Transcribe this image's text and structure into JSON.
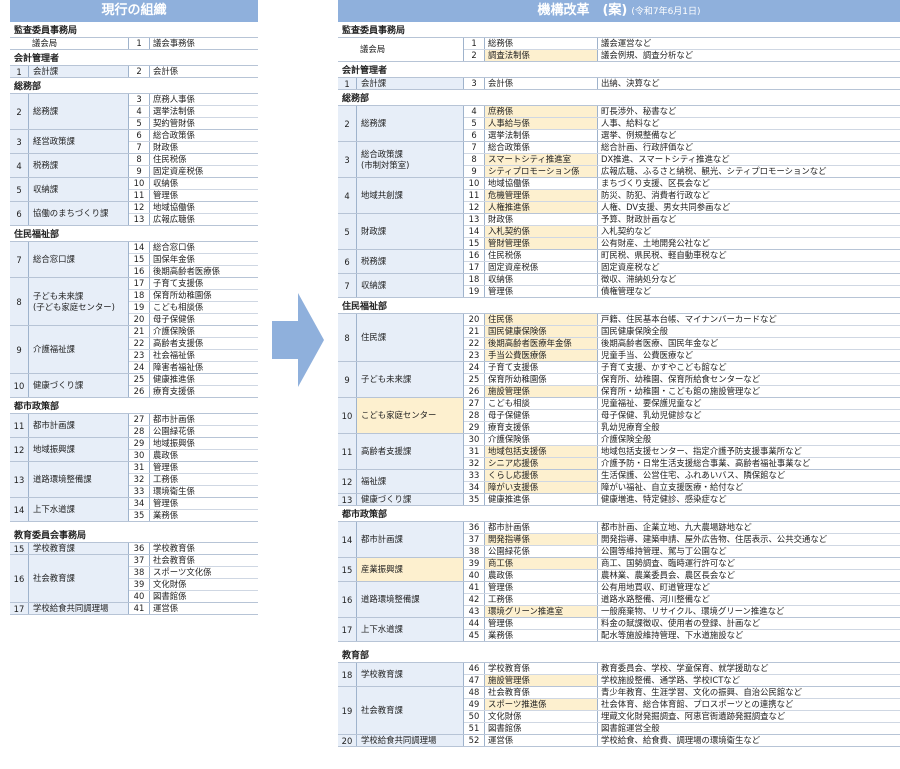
{
  "colors": {
    "header": "#8fb0dc",
    "dept_bg": "#e7eef8",
    "highlight": "#fdf0cf"
  },
  "left": {
    "title": "現行の組織",
    "sections": [
      {
        "name": "監査委員事務局",
        "blocks": [
          {
            "num": "",
            "dept": "議会局",
            "white": true,
            "rows": [
              {
                "n": "1",
                "s": "議会事務係"
              }
            ]
          }
        ]
      },
      {
        "name": "会計管理者",
        "blocks": [
          {
            "num": "1",
            "dept": "会計課",
            "rows": [
              {
                "n": "2",
                "s": "会計係"
              }
            ]
          }
        ]
      },
      {
        "name": "総務部",
        "blocks": [
          {
            "num": "2",
            "dept": "総務課",
            "rows": [
              {
                "n": "3",
                "s": "庶務人事係"
              },
              {
                "n": "4",
                "s": "選挙法制係"
              },
              {
                "n": "5",
                "s": "契約管財係"
              }
            ]
          },
          {
            "num": "3",
            "dept": "経営政策課",
            "rows": [
              {
                "n": "6",
                "s": "総合政策係"
              },
              {
                "n": "7",
                "s": "財政係"
              }
            ]
          },
          {
            "num": "4",
            "dept": "税務課",
            "rows": [
              {
                "n": "8",
                "s": "住民税係"
              },
              {
                "n": "9",
                "s": "固定資産税係"
              }
            ]
          },
          {
            "num": "5",
            "dept": "収納課",
            "rows": [
              {
                "n": "10",
                "s": "収納係"
              },
              {
                "n": "11",
                "s": "管理係"
              }
            ]
          },
          {
            "num": "6",
            "dept": "協働のまちづくり課",
            "rows": [
              {
                "n": "12",
                "s": "地域協働係"
              },
              {
                "n": "13",
                "s": "広報広聴係"
              }
            ]
          }
        ]
      },
      {
        "name": "住民福祉部",
        "blocks": [
          {
            "num": "7",
            "dept": "総合窓口課",
            "rows": [
              {
                "n": "14",
                "s": "総合窓口係"
              },
              {
                "n": "15",
                "s": "国保年金係"
              },
              {
                "n": "16",
                "s": "後期高齢者医療係"
              }
            ]
          },
          {
            "num": "8",
            "dept": "子ども未来課\n(子ども家庭センター)",
            "rows": [
              {
                "n": "17",
                "s": "子育て支援係"
              },
              {
                "n": "18",
                "s": "保育所幼稚園係"
              },
              {
                "n": "19",
                "s": "こども相談係"
              },
              {
                "n": "20",
                "s": "母子保健係"
              }
            ]
          },
          {
            "num": "9",
            "dept": "介護福祉課",
            "rows": [
              {
                "n": "21",
                "s": "介護保険係"
              },
              {
                "n": "22",
                "s": "高齢者支援係"
              },
              {
                "n": "23",
                "s": "社会福祉係"
              },
              {
                "n": "24",
                "s": "障害者福祉係"
              }
            ]
          },
          {
            "num": "10",
            "dept": "健康づくり課",
            "rows": [
              {
                "n": "25",
                "s": "健康推進係"
              },
              {
                "n": "26",
                "s": "療育支援係"
              }
            ]
          }
        ]
      },
      {
        "name": "都市政策部",
        "blocks": [
          {
            "num": "11",
            "dept": "都市計画課",
            "rows": [
              {
                "n": "27",
                "s": "都市計画係"
              },
              {
                "n": "28",
                "s": "公園緑花係"
              }
            ]
          },
          {
            "num": "12",
            "dept": "地域振興課",
            "rows": [
              {
                "n": "29",
                "s": "地域振興係"
              },
              {
                "n": "30",
                "s": "農政係"
              }
            ]
          },
          {
            "num": "13",
            "dept": "道路環境整備課",
            "rows": [
              {
                "n": "31",
                "s": "管理係"
              },
              {
                "n": "32",
                "s": "工務係"
              },
              {
                "n": "33",
                "s": "環境衛生係"
              }
            ]
          },
          {
            "num": "14",
            "dept": "上下水道課",
            "rows": [
              {
                "n": "34",
                "s": "管理係"
              },
              {
                "n": "35",
                "s": "業務係"
              }
            ]
          }
        ]
      },
      {
        "name": "教育委員会事務局",
        "gap": true,
        "blocks": [
          {
            "num": "15",
            "dept": "学校教育課",
            "rows": [
              {
                "n": "36",
                "s": "学校教育係"
              }
            ]
          },
          {
            "num": "16",
            "dept": "社会教育課",
            "rows": [
              {
                "n": "37",
                "s": "社会教育係"
              },
              {
                "n": "38",
                "s": "スポーツ文化係"
              },
              {
                "n": "39",
                "s": "文化財係"
              },
              {
                "n": "40",
                "s": "図書館係"
              }
            ]
          },
          {
            "num": "17",
            "dept": "学校給食共同調理場",
            "rows": [
              {
                "n": "41",
                "s": "運営係"
              }
            ]
          }
        ]
      }
    ]
  },
  "right": {
    "title": "機構改革　(案)",
    "date": "(令和7年6月1日)",
    "sections": [
      {
        "name": "監査委員事務局",
        "blocks": [
          {
            "num": "",
            "dept": "議会局",
            "white": true,
            "rows": [
              {
                "n": "1",
                "s": "総務係",
                "d": "議会運営など"
              },
              {
                "n": "2",
                "s": "調査法制係",
                "d": "議会例規、調査分析など",
                "hl": true
              }
            ]
          }
        ]
      },
      {
        "name": "会計管理者",
        "blocks": [
          {
            "num": "1",
            "dept": "会計課",
            "rows": [
              {
                "n": "3",
                "s": "会計係",
                "d": "出納、決算など"
              }
            ]
          }
        ]
      },
      {
        "name": "総務部",
        "blocks": [
          {
            "num": "2",
            "dept": "総務課",
            "rows": [
              {
                "n": "4",
                "s": "庶務係",
                "d": "町長渉外、秘書など",
                "hl": true
              },
              {
                "n": "5",
                "s": "人事給与係",
                "d": "人事、給料など",
                "hl": true
              },
              {
                "n": "6",
                "s": "選挙法制係",
                "d": "選挙、例規整備など"
              }
            ]
          },
          {
            "num": "3",
            "dept": "総合政策課\n(市制対策室)",
            "rows": [
              {
                "n": "7",
                "s": "総合政策係",
                "d": "総合計画、行政評価など"
              },
              {
                "n": "8",
                "s": "スマートシティ推進室",
                "d": "DX推進、スマートシティ推進など",
                "hl": true
              },
              {
                "n": "9",
                "s": "シティプロモーション係",
                "d": "広報広聴、ふるさと納税、観光、シティプロモーションなど",
                "hl": true
              }
            ]
          },
          {
            "num": "4",
            "dept": "地域共創課",
            "rows": [
              {
                "n": "10",
                "s": "地域協働係",
                "d": "まちづくり支援、区長会など"
              },
              {
                "n": "11",
                "s": "危機管理係",
                "d": "防災、防犯、消費者行政など",
                "hl": true
              },
              {
                "n": "12",
                "s": "人権推進係",
                "d": "人権、DV支援、男女共同参画など",
                "hl": true
              }
            ]
          },
          {
            "num": "5",
            "dept": "財政課",
            "rows": [
              {
                "n": "13",
                "s": "財政係",
                "d": "予算、財政計画など"
              },
              {
                "n": "14",
                "s": "入札契約係",
                "d": "入札契約など",
                "hl": true
              },
              {
                "n": "15",
                "s": "管財管理係",
                "d": "公有財産、土地開発公社など",
                "hl": true
              }
            ]
          },
          {
            "num": "6",
            "dept": "税務課",
            "rows": [
              {
                "n": "16",
                "s": "住民税係",
                "d": "町民税、県民税、軽自動車税など"
              },
              {
                "n": "17",
                "s": "固定資産税係",
                "d": "固定資産税など"
              }
            ]
          },
          {
            "num": "7",
            "dept": "収納課",
            "rows": [
              {
                "n": "18",
                "s": "収納係",
                "d": "徴収、滞納処分など"
              },
              {
                "n": "19",
                "s": "管理係",
                "d": "債権管理など"
              }
            ]
          }
        ]
      },
      {
        "name": "住民福祉部",
        "blocks": [
          {
            "num": "8",
            "dept": "住民課",
            "rows": [
              {
                "n": "20",
                "s": "住民係",
                "d": "戸籍、住民基本台帳、マイナンバーカードなど",
                "hl": true
              },
              {
                "n": "21",
                "s": "国民健康保険係",
                "d": "国民健康保険全般",
                "hl": true
              },
              {
                "n": "22",
                "s": "後期高齢者医療年金係",
                "d": "後期高齢者医療、国民年金など",
                "hl": true
              },
              {
                "n": "23",
                "s": "手当公費医療係",
                "d": "児童手当、公費医療など",
                "hl": true
              }
            ]
          },
          {
            "num": "9",
            "dept": "子ども未来課",
            "rows": [
              {
                "n": "24",
                "s": "子育て支援係",
                "d": "子育て支援、かすやこども館など"
              },
              {
                "n": "25",
                "s": "保育所幼稚園係",
                "d": "保育所、幼稚園、保育所給食センターなど"
              },
              {
                "n": "26",
                "s": "施設管理係",
                "d": "保育所・幼稚園・こども館の施設管理など",
                "hl": true
              }
            ]
          },
          {
            "num": "10",
            "dept": "こども家庭センター",
            "hl": true,
            "rows": [
              {
                "n": "27",
                "s": "こども相談",
                "d": "児童福祉、要保護児童など"
              },
              {
                "n": "28",
                "s": "母子保健係",
                "d": "母子保健、乳幼児健診など"
              },
              {
                "n": "29",
                "s": "療育支援係",
                "d": "乳幼児療育全般"
              }
            ]
          },
          {
            "num": "11",
            "dept": "高齢者支援課",
            "rows": [
              {
                "n": "30",
                "s": "介護保険係",
                "d": "介護保険全般"
              },
              {
                "n": "31",
                "s": "地域包括支援係",
                "d": "地域包括支援センター、指定介護予防支援事業所など",
                "hl": true
              },
              {
                "n": "32",
                "s": "シニア応援係",
                "d": "介護予防・日常生活支援総合事業、高齢者福祉事業など",
                "hl": true
              }
            ]
          },
          {
            "num": "12",
            "dept": "福祉課",
            "rows": [
              {
                "n": "33",
                "s": "くらし応援係",
                "d": "生活保護、公営住宅、ふれあいバス、隣保館など",
                "hl": true
              },
              {
                "n": "34",
                "s": "障がい支援係",
                "d": "障がい福祉、自立支援医療・給付など",
                "hl": true
              }
            ]
          },
          {
            "num": "13",
            "dept": "健康づくり課",
            "rows": [
              {
                "n": "35",
                "s": "健康推進係",
                "d": "健康増進、特定健診、感染症など"
              }
            ]
          }
        ]
      },
      {
        "name": "都市政策部",
        "blocks": [
          {
            "num": "14",
            "dept": "都市計画課",
            "rows": [
              {
                "n": "36",
                "s": "都市計画係",
                "d": "都市計画、企業立地、九大農場跡地など"
              },
              {
                "n": "37",
                "s": "開発指導係",
                "d": "開発指導、建築申請、屋外広告物、住居表示、公共交通など",
                "hl": true
              },
              {
                "n": "38",
                "s": "公園緑花係",
                "d": "公園等維持管理、駕与丁公園など"
              }
            ]
          },
          {
            "num": "15",
            "dept": "産業振興課",
            "hl": true,
            "rows": [
              {
                "n": "39",
                "s": "商工係",
                "d": "商工、国勢調査、臨時運行許可など",
                "hl": true
              },
              {
                "n": "40",
                "s": "農政係",
                "d": "農林業、農業委員会、農区長会など"
              }
            ]
          },
          {
            "num": "16",
            "dept": "道路環境整備課",
            "rows": [
              {
                "n": "41",
                "s": "管理係",
                "d": "公有用地買収、町道管理など"
              },
              {
                "n": "42",
                "s": "工務係",
                "d": "道路水路整備、河川整備など"
              },
              {
                "n": "43",
                "s": "環境グリーン推進室",
                "d": "一般廃棄物、リサイクル、環境グリーン推進など",
                "hl": true
              }
            ]
          },
          {
            "num": "17",
            "dept": "上下水道課",
            "rows": [
              {
                "n": "44",
                "s": "管理係",
                "d": "料金の賦課徴収、使用者の登録、計画など"
              },
              {
                "n": "45",
                "s": "業務係",
                "d": "配水等施設維持管理、下水道施設など"
              }
            ]
          }
        ]
      },
      {
        "name": "教育部",
        "gap": true,
        "blocks": [
          {
            "num": "18",
            "dept": "学校教育課",
            "rows": [
              {
                "n": "46",
                "s": "学校教育係",
                "d": "教育委員会、学校、学童保育、就学援助など"
              },
              {
                "n": "47",
                "s": "施設管理係",
                "d": "学校施設整備、通学路、学校ICTなど",
                "hl": true
              }
            ]
          },
          {
            "num": "19",
            "dept": "社会教育課",
            "rows": [
              {
                "n": "48",
                "s": "社会教育係",
                "d": "青少年教育、生涯学習、文化の振興、自治公民館など"
              },
              {
                "n": "49",
                "s": "スポーツ推進係",
                "d": "社会体育、総合体育館、プロスポーツとの連携など",
                "hl": true
              },
              {
                "n": "50",
                "s": "文化財係",
                "d": "埋蔵文化財発掘調査、阿恵官衙遺跡発掘調査など"
              },
              {
                "n": "51",
                "s": "図書館係",
                "d": "図書館運営全般"
              }
            ]
          },
          {
            "num": "20",
            "dept": "学校給食共同調理場",
            "rows": [
              {
                "n": "52",
                "s": "運営係",
                "d": "学校給食、給食費、調理場の環境衛生など"
              }
            ]
          }
        ]
      }
    ]
  }
}
